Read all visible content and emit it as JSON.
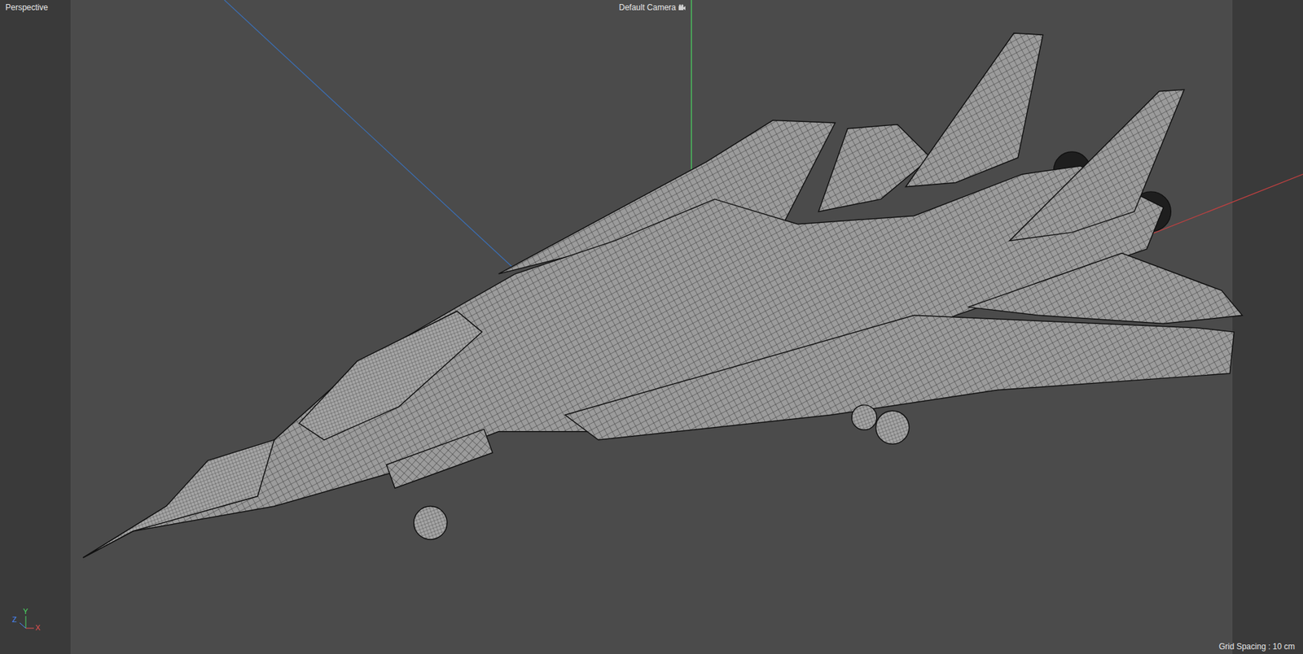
{
  "viewport": {
    "view_label": "Perspective",
    "camera_label": "Default Camera",
    "grid_spacing": "Grid Spacing : 10 cm"
  },
  "axis_gizmo": {
    "labels": [
      {
        "text": "Z",
        "color": "#4a8cff"
      },
      {
        "text": "Y",
        "color": "#4cd964"
      },
      {
        "text": "X",
        "color": "#e05050"
      }
    ]
  }
}
